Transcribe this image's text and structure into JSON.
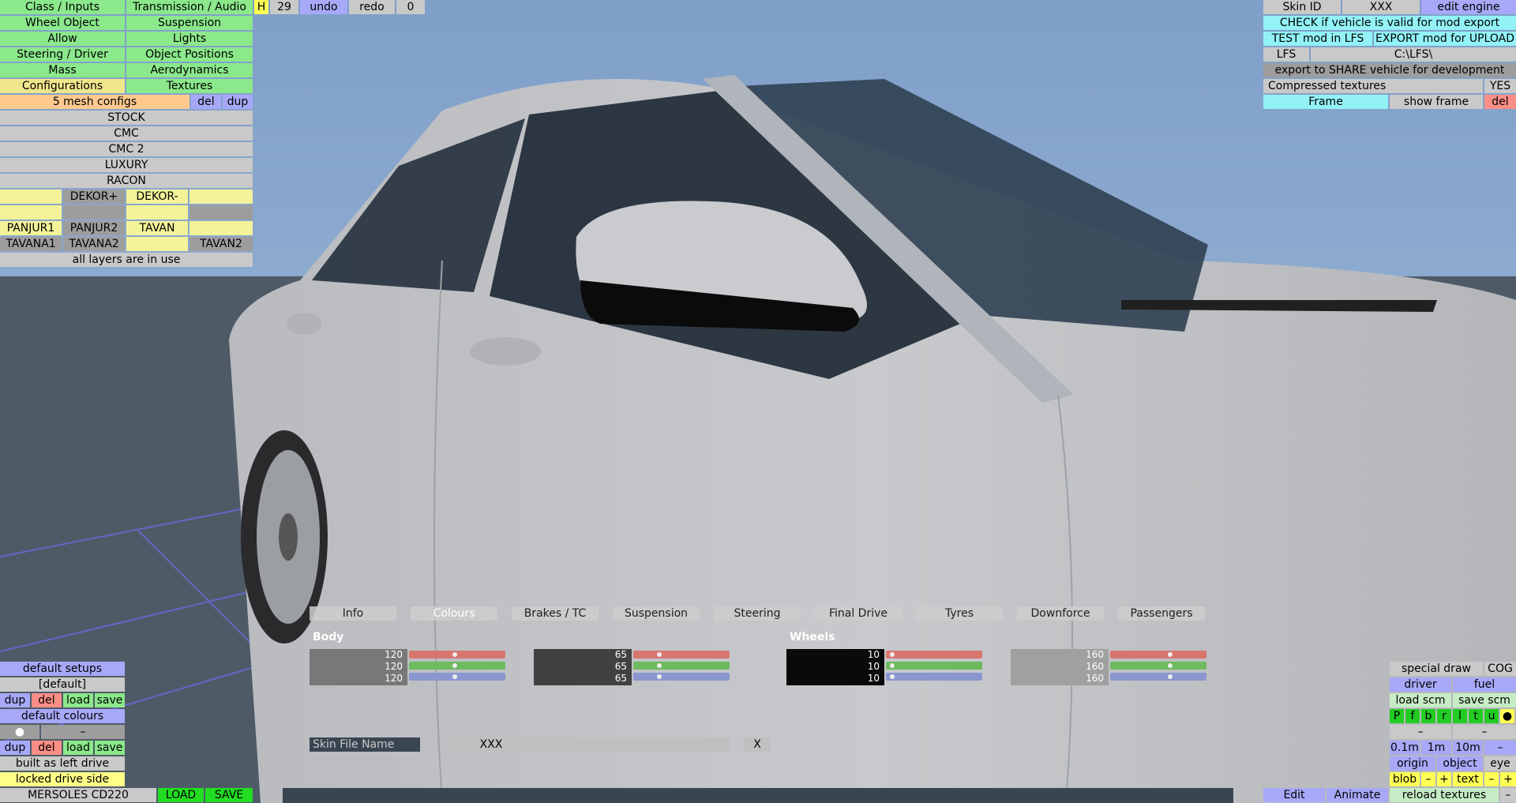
{
  "left_menu": {
    "rows": [
      [
        "Class / Inputs",
        "Transmission / Audio"
      ],
      [
        "Wheel Object",
        "Suspension"
      ],
      [
        "Allow",
        "Lights"
      ],
      [
        "Steering / Driver",
        "Object Positions"
      ],
      [
        "Mass",
        "Aerodynamics"
      ],
      [
        "Configurations",
        "Textures"
      ]
    ],
    "mesh_configs": "5 mesh configs",
    "del": "del",
    "dup": "dup",
    "configs": [
      "STOCK",
      "CMC",
      "CMC 2",
      "LUXURY",
      "RACON"
    ],
    "layers": {
      "dekor_plus": "DEKOR+",
      "dekor_minus": "DEKOR-",
      "panjur1": "PANJUR1",
      "panjur2": "PANJUR2",
      "tavan": "TAVAN",
      "tavana1": "TAVANA1",
      "tavana2": "TAVANA2",
      "tavan2": "TAVAN2"
    },
    "all_layers": "all layers are in use"
  },
  "top_toolbar": {
    "h": "H",
    "count": "29",
    "undo": "undo",
    "redo": "redo",
    "zero": "0"
  },
  "right_panel": {
    "skin_id": "Skin ID",
    "xxx": "XXX",
    "edit_engine": "edit engine",
    "check": "CHECK if vehicle is valid for mod export",
    "test": "TEST mod in LFS",
    "export": "EXPORT mod for UPLOAD",
    "lfs": "LFS",
    "path": "C:\\LFS\\",
    "share": "export to SHARE vehicle for development",
    "compressed": "Compressed textures",
    "yes": "YES",
    "frame": "Frame",
    "show_frame": "show frame",
    "del": "del"
  },
  "tabs": [
    "Info",
    "Colours",
    "Brakes / TC",
    "Suspension",
    "Steering",
    "Final Drive",
    "Tyres",
    "Downforce",
    "Passengers"
  ],
  "active_tab": "Colours",
  "colours": {
    "body_label": "Body",
    "wheels_label": "Wheels",
    "swatches": [
      {
        "r": "120",
        "g": "120",
        "b": "120",
        "color": "#787878"
      },
      {
        "r": "65",
        "g": "65",
        "b": "65",
        "color": "#414141"
      },
      {
        "r": "10",
        "g": "10",
        "b": "10",
        "color": "#0a0a0a"
      },
      {
        "r": "160",
        "g": "160",
        "b": "160",
        "color": "#a0a0a0"
      }
    ]
  },
  "skin": {
    "label": "Skin File Name",
    "value": "XXX",
    "close": "X"
  },
  "bottom_left": {
    "default_setups": "default setups",
    "default": "[default]",
    "dup": "dup",
    "del": "del",
    "load": "load",
    "save": "save",
    "default_colours": "default colours",
    "dot": "●",
    "dash": "–",
    "left_drive": "built as left drive",
    "locked": "locked drive side",
    "car_name": "MERSOLES CD220",
    "load_btn": "LOAD",
    "save_btn": "SAVE"
  },
  "bottom_right": {
    "special_draw": "special draw",
    "cog": "COG",
    "driver": "driver",
    "fuel": "fuel",
    "load_scm": "load scm",
    "save_scm": "save scm",
    "letters": [
      "P",
      "f",
      "b",
      "r",
      "l",
      "t",
      "u",
      "●"
    ],
    "dash": "–",
    "zoom": [
      "0.1m",
      "1m",
      "10m",
      "–"
    ],
    "origin": "origin",
    "object": "object",
    "eye": "eye",
    "blob": "blob",
    "minus": "–",
    "plus": "+",
    "text": "text",
    "edit": "Edit",
    "animate": "Animate",
    "reload": "reload textures"
  },
  "colors": {
    "sky": "#7f9fc9",
    "ground": "#4d5a66",
    "car": "#c3c5c8"
  }
}
